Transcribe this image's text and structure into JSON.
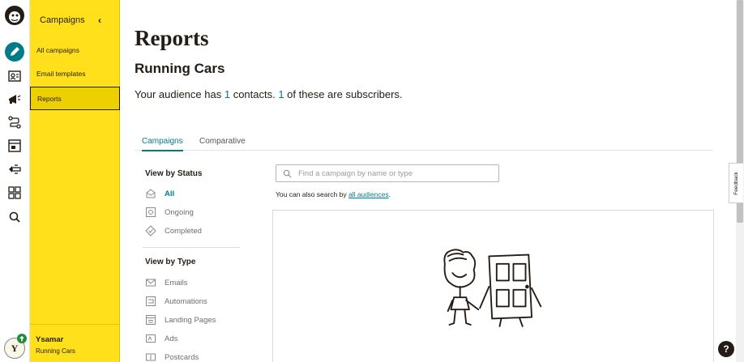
{
  "rail": {
    "icons": [
      "mailchimp-logo-icon",
      "create-pencil-icon",
      "audience-icon",
      "campaigns-megaphone-icon",
      "automations-icon",
      "landing-pages-icon",
      "integrations-icon",
      "apps-grid-icon",
      "search-icon"
    ]
  },
  "panel": {
    "heading": "Campaigns",
    "items": [
      {
        "label": "All campaigns"
      },
      {
        "label": "Email templates"
      },
      {
        "label": "Reports"
      }
    ],
    "user_name": "Ysamar",
    "user_org": "Running Cars",
    "avatar_initial": "Y"
  },
  "main": {
    "title": "Reports",
    "subtitle": "Running Cars",
    "audience": {
      "prefix": "Your audience has ",
      "contacts": "1",
      "middle": " contacts. ",
      "subscribers": "1",
      "suffix": " of these are subscribers."
    },
    "tabs": [
      {
        "label": "Campaigns"
      },
      {
        "label": "Comparative"
      }
    ],
    "view_by_status": {
      "heading": "View by Status",
      "items": [
        {
          "label": "All"
        },
        {
          "label": "Ongoing"
        },
        {
          "label": "Completed"
        }
      ]
    },
    "view_by_type": {
      "heading": "View by Type",
      "items": [
        {
          "label": "Emails"
        },
        {
          "label": "Automations"
        },
        {
          "label": "Landing Pages"
        },
        {
          "label": "Ads"
        },
        {
          "label": "Postcards"
        }
      ]
    },
    "search": {
      "placeholder": "Find a campaign by name or type",
      "hint_prefix": "You can also search by ",
      "hint_link": "all audiences",
      "hint_suffix": "."
    }
  },
  "feedback_label": "Feedback",
  "help_label": "?",
  "colors": {
    "accent": "#007c89",
    "panel_yellow": "#ffe01b",
    "text": "#241c15"
  }
}
